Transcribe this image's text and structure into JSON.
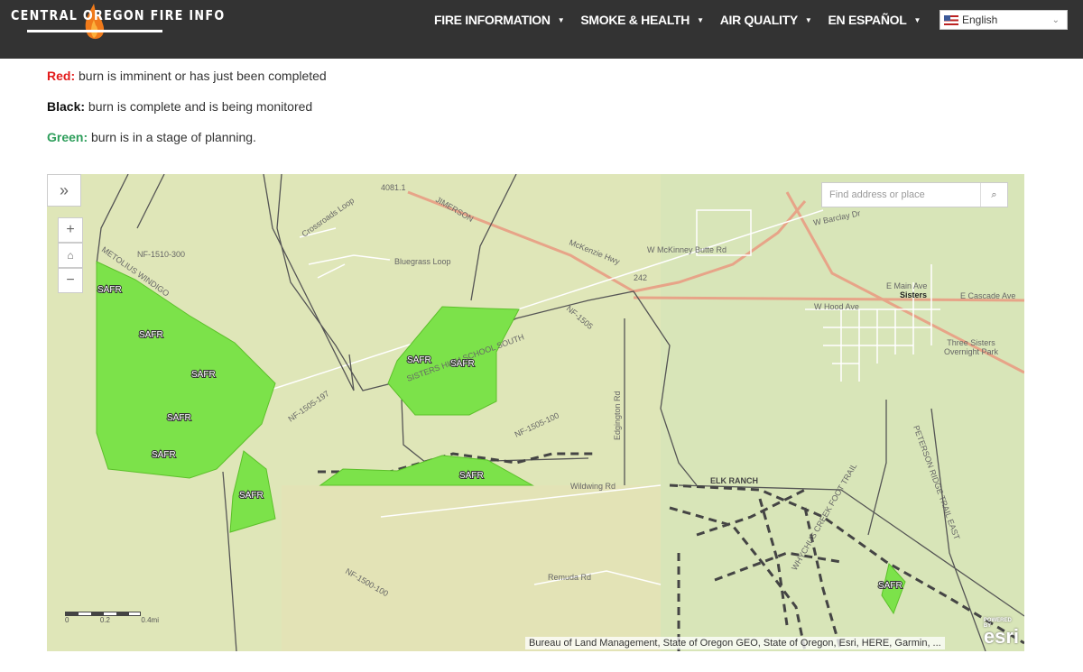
{
  "header": {
    "logo_text": "CENTRAL OREGON FIRE INFO",
    "nav": [
      {
        "label": "FIRE INFORMATION"
      },
      {
        "label": "SMOKE & HEALTH"
      },
      {
        "label": "AIR QUALITY"
      },
      {
        "label": "EN ESPAÑOL"
      }
    ],
    "language_select": {
      "value": "English"
    }
  },
  "legend": [
    {
      "key": "Red:",
      "text": " burn is imminent or has just been completed",
      "color": "#e31b1b"
    },
    {
      "key": "Black:",
      "text": " burn is complete and is being monitored",
      "color": "#111111"
    },
    {
      "key": "Green:",
      "text": " burn is in a stage of planning.",
      "color": "#2e9e5b"
    }
  ],
  "map": {
    "search_placeholder": "Find address or place",
    "attribution": "Bureau of Land Management, State of Oregon GEO, State of Oregon, Esri, HERE, Garmin, ...",
    "esri_powered": "POWERED BY",
    "esri_logo": "esri",
    "scale": {
      "labels": [
        "0",
        "0.2",
        "0.4mi"
      ]
    },
    "burn_label": "SAFR",
    "burn_fill": "#7ce24a",
    "place_labels": [
      "Crossroads Loop",
      "Bluegrass Loop",
      "NF-1510-300",
      "METOLIUS WINDIGO",
      "McKenzie Hwy",
      "W McKinney Butte Rd",
      "W Barclay Dr",
      "Sisters",
      "E Main Ave",
      "E Cascade Ave",
      "W Hood Ave",
      "NF-1505",
      "NF-1505-197",
      "NF-1505-100",
      "Wildwing Rd",
      "ELK RANCH",
      "Edgington Rd",
      "Remuda Rd",
      "NF-1500-100",
      "PETERSON RIDGE TRAIL EAST",
      "WHYCHUS CREEK FOOT TRAIL",
      "Three Sisters Overnight Park",
      "JIMERSON",
      "4081.1",
      "242",
      "SISTERS HIGH SCHOOL SOUTH"
    ]
  }
}
